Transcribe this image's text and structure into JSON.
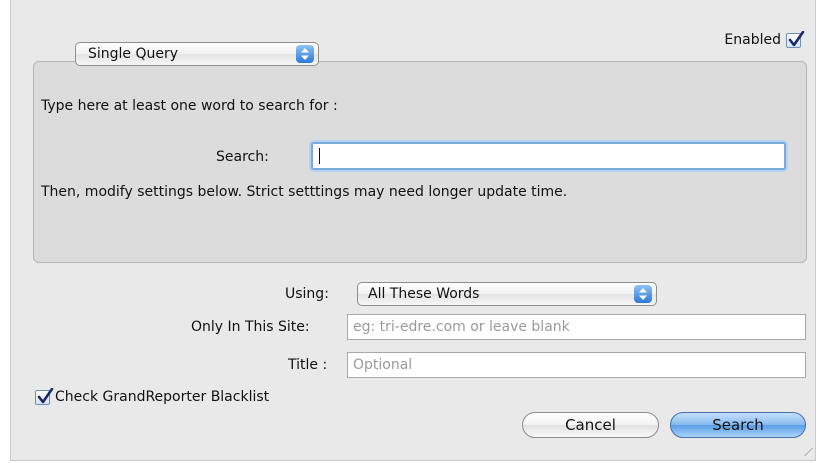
{
  "enabled": {
    "label": "Enabled",
    "checked": true
  },
  "query_mode": {
    "selected": "Single Query"
  },
  "instructions": {
    "line1": "Type here at least one word to search for :",
    "line2": "Then, modify settings below. Strict setttings may need longer update time."
  },
  "search_field": {
    "label": "Search:",
    "value": ""
  },
  "using": {
    "label": "Using:",
    "selected": "All These Words"
  },
  "site": {
    "label": "Only In This Site:",
    "placeholder": "eg: tri-edre.com or leave blank"
  },
  "title_field": {
    "label": "Title :",
    "placeholder": "Optional"
  },
  "blacklist": {
    "label": "Check GrandReporter Blacklist",
    "checked": true
  },
  "buttons": {
    "cancel": "Cancel",
    "search": "Search"
  },
  "icons": {
    "checkmark": "checkmark-icon",
    "popup_arrows": "updown-arrows-icon"
  },
  "colors": {
    "accent": "#5b9de6",
    "focus_ring": "#7aa8df"
  }
}
